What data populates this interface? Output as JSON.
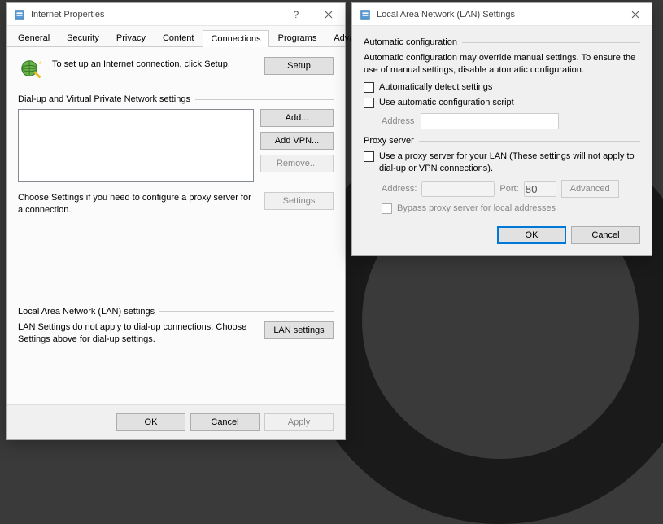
{
  "ip": {
    "title": "Internet Properties",
    "tabs": [
      "General",
      "Security",
      "Privacy",
      "Content",
      "Connections",
      "Programs",
      "Advanced"
    ],
    "active_tab": "Connections",
    "setup_text": "To set up an Internet connection, click Setup.",
    "setup_btn": "Setup",
    "dial_label": "Dial-up and Virtual Private Network settings",
    "add_btn": "Add...",
    "addvpn_btn": "Add VPN...",
    "remove_btn": "Remove...",
    "settings_btn": "Settings",
    "settings_desc": "Choose Settings if you need to configure a proxy server for a connection.",
    "lan_label": "Local Area Network (LAN) settings",
    "lan_desc": "LAN Settings do not apply to dial-up connections. Choose Settings above for dial-up settings.",
    "lan_btn": "LAN settings",
    "ok": "OK",
    "cancel": "Cancel",
    "apply": "Apply",
    "help": "?"
  },
  "lan": {
    "title": "Local Area Network (LAN) Settings",
    "auto_label": "Automatic configuration",
    "auto_desc": "Automatic configuration may override manual settings.  To ensure the use of manual settings, disable automatic configuration.",
    "auto_detect": "Automatically detect settings",
    "auto_script": "Use automatic configuration script",
    "address_label": "Address",
    "proxy_label": "Proxy server",
    "proxy_use": "Use a proxy server for your LAN (These settings will not apply to dial-up or VPN connections).",
    "proxy_addr_label": "Address:",
    "proxy_port_label": "Port:",
    "proxy_port_value": "80",
    "proxy_advanced": "Advanced",
    "proxy_bypass": "Bypass proxy server for local addresses",
    "ok": "OK",
    "cancel": "Cancel"
  }
}
